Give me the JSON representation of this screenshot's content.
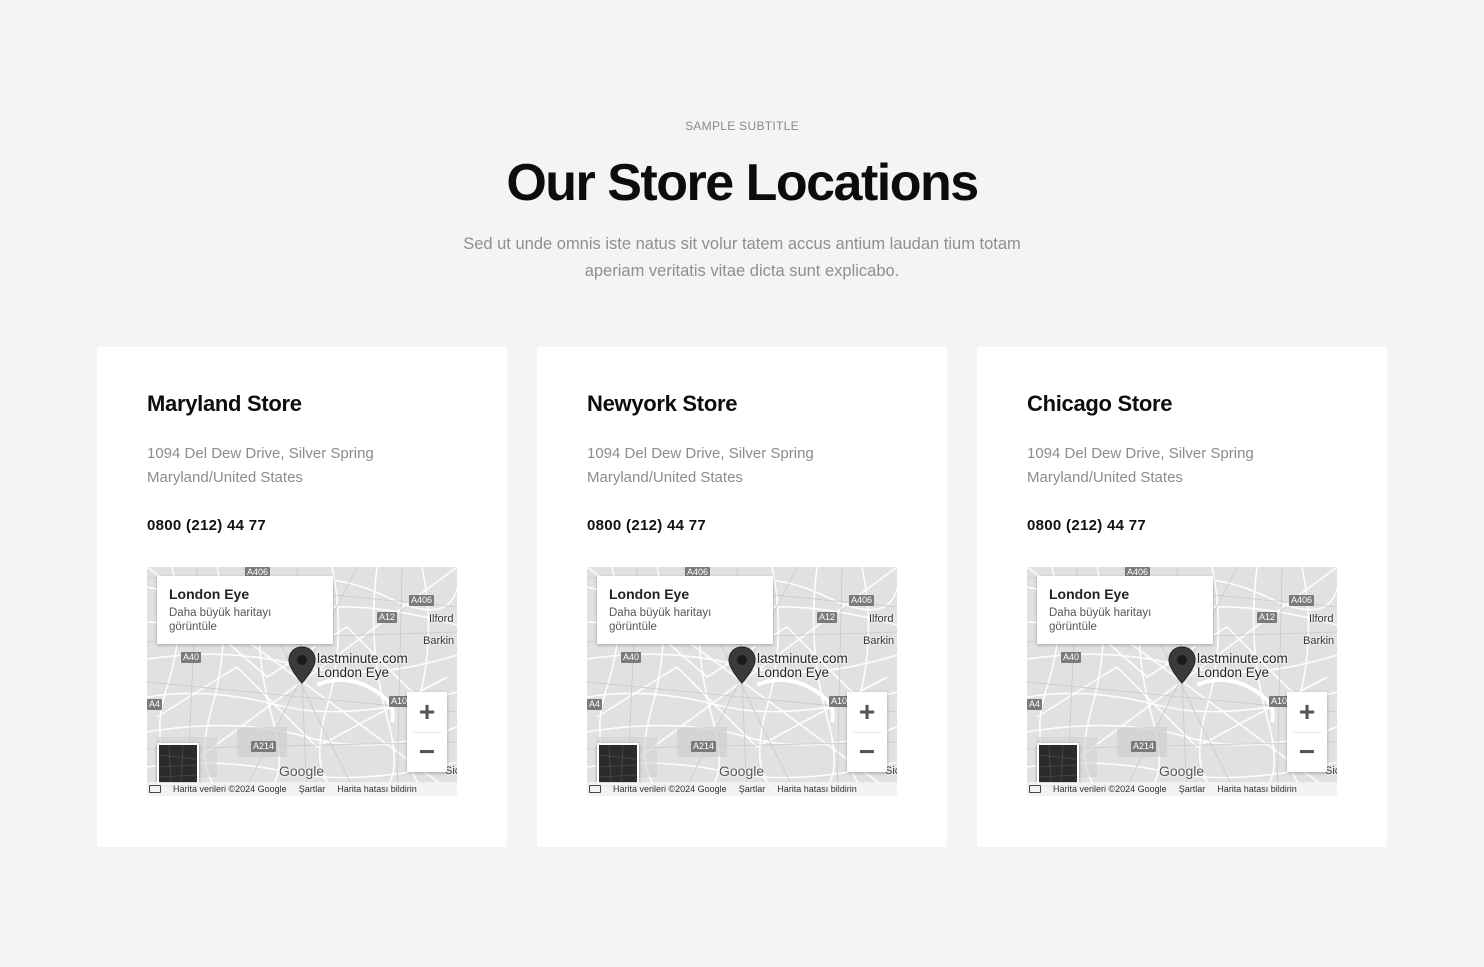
{
  "header": {
    "subtitle": "SAMPLE SUBTITLE",
    "title": "Our Store Locations",
    "description": "Sed ut unde omnis iste natus sit volur tatem accus antium laudan tium totam aperiam veritatis vitae dicta sunt explicabo."
  },
  "stores": [
    {
      "name": "Maryland Store",
      "address_line1": "1094 Del Dew Drive, Silver Spring",
      "address_line2": "Maryland/United States",
      "phone": "0800 (212) 44 77"
    },
    {
      "name": "Newyork Store",
      "address_line1": "1094 Del Dew Drive, Silver Spring",
      "address_line2": "Maryland/United States",
      "phone": "0800 (212) 44 77"
    },
    {
      "name": "Chicago Store",
      "address_line1": "1094 Del Dew Drive, Silver Spring",
      "address_line2": "Maryland/United States",
      "phone": "0800 (212) 44 77"
    }
  ],
  "map": {
    "place_title": "London Eye",
    "view_larger": "Daha büyük haritayı görüntüle",
    "marker_label_1": "lastminute.com",
    "marker_label_2": "London Eye",
    "zoom_in": "+",
    "zoom_out": "−",
    "logo": "Google",
    "attribution_data": "Harita verileri ©2024 Google",
    "attribution_terms": "Şartlar",
    "attribution_report": "Harita hatası bildirin",
    "labels": [
      "Ilford",
      "Barkin",
      "Sic"
    ],
    "roads": [
      "A406",
      "A406",
      "A12",
      "A40",
      "A4",
      "A10",
      "A214"
    ],
    "icons": {
      "marker": "map-pin-icon",
      "keyboard": "keyboard-icon"
    }
  }
}
